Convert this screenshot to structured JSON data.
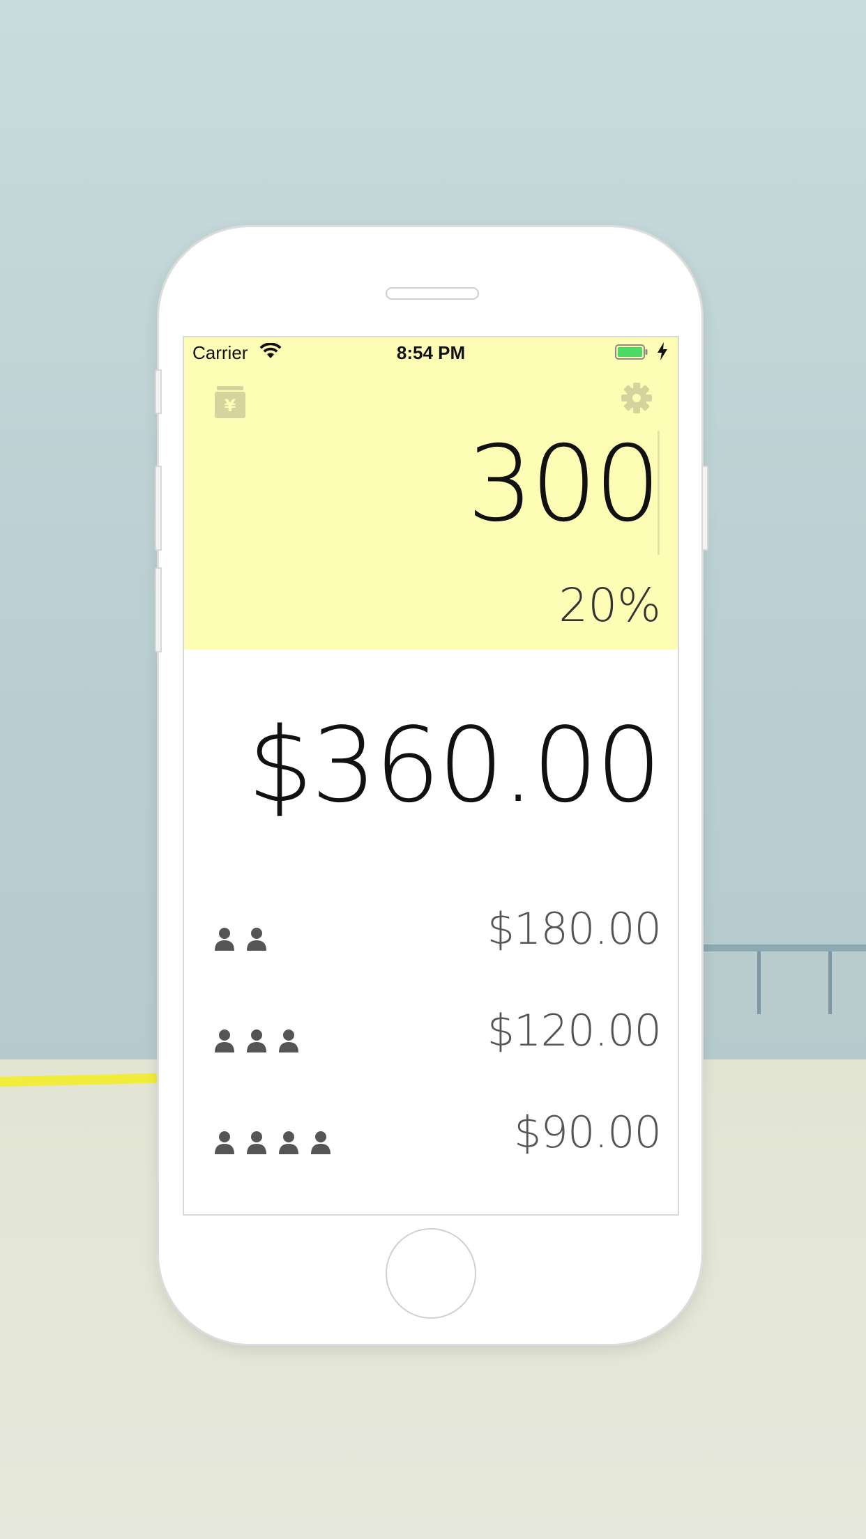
{
  "status_bar": {
    "carrier": "Carrier",
    "time": "8:54 PM"
  },
  "icons": {
    "wallet": "yen-wallet-icon",
    "settings": "gear-icon",
    "person": "person-icon",
    "wifi": "wifi-icon",
    "battery": "battery-icon",
    "charging": "charging-bolt-icon"
  },
  "bill": {
    "amount": "300",
    "tip_percent": "20%"
  },
  "total": "$360.00",
  "splits": [
    {
      "people": 2,
      "amount": "$180.00"
    },
    {
      "people": 3,
      "amount": "$120.00"
    },
    {
      "people": 4,
      "amount": "$90.00"
    }
  ],
  "colors": {
    "panel": "#fdfdb6",
    "icon_muted": "#d6d49c",
    "person": "#555555",
    "battery": "#4cd964"
  }
}
